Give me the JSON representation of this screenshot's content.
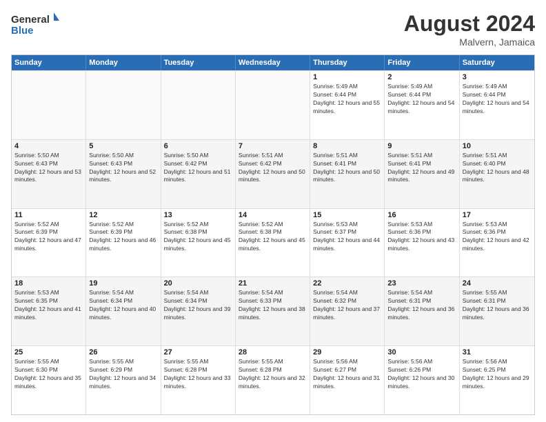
{
  "logo": {
    "general": "General",
    "blue": "Blue"
  },
  "header": {
    "title": "August 2024",
    "subtitle": "Malvern, Jamaica"
  },
  "days": [
    "Sunday",
    "Monday",
    "Tuesday",
    "Wednesday",
    "Thursday",
    "Friday",
    "Saturday"
  ],
  "rows": [
    [
      {
        "day": "",
        "empty": true
      },
      {
        "day": "",
        "empty": true
      },
      {
        "day": "",
        "empty": true
      },
      {
        "day": "",
        "empty": true
      },
      {
        "day": "1",
        "sunrise": "5:49 AM",
        "sunset": "6:44 PM",
        "daylight": "12 hours and 55 minutes."
      },
      {
        "day": "2",
        "sunrise": "5:49 AM",
        "sunset": "6:44 PM",
        "daylight": "12 hours and 54 minutes."
      },
      {
        "day": "3",
        "sunrise": "5:49 AM",
        "sunset": "6:44 PM",
        "daylight": "12 hours and 54 minutes."
      }
    ],
    [
      {
        "day": "4",
        "sunrise": "5:50 AM",
        "sunset": "6:43 PM",
        "daylight": "12 hours and 53 minutes."
      },
      {
        "day": "5",
        "sunrise": "5:50 AM",
        "sunset": "6:43 PM",
        "daylight": "12 hours and 52 minutes."
      },
      {
        "day": "6",
        "sunrise": "5:50 AM",
        "sunset": "6:42 PM",
        "daylight": "12 hours and 51 minutes."
      },
      {
        "day": "7",
        "sunrise": "5:51 AM",
        "sunset": "6:42 PM",
        "daylight": "12 hours and 50 minutes."
      },
      {
        "day": "8",
        "sunrise": "5:51 AM",
        "sunset": "6:41 PM",
        "daylight": "12 hours and 50 minutes."
      },
      {
        "day": "9",
        "sunrise": "5:51 AM",
        "sunset": "6:41 PM",
        "daylight": "12 hours and 49 minutes."
      },
      {
        "day": "10",
        "sunrise": "5:51 AM",
        "sunset": "6:40 PM",
        "daylight": "12 hours and 48 minutes."
      }
    ],
    [
      {
        "day": "11",
        "sunrise": "5:52 AM",
        "sunset": "6:39 PM",
        "daylight": "12 hours and 47 minutes."
      },
      {
        "day": "12",
        "sunrise": "5:52 AM",
        "sunset": "6:39 PM",
        "daylight": "12 hours and 46 minutes."
      },
      {
        "day": "13",
        "sunrise": "5:52 AM",
        "sunset": "6:38 PM",
        "daylight": "12 hours and 45 minutes."
      },
      {
        "day": "14",
        "sunrise": "5:52 AM",
        "sunset": "6:38 PM",
        "daylight": "12 hours and 45 minutes."
      },
      {
        "day": "15",
        "sunrise": "5:53 AM",
        "sunset": "6:37 PM",
        "daylight": "12 hours and 44 minutes."
      },
      {
        "day": "16",
        "sunrise": "5:53 AM",
        "sunset": "6:36 PM",
        "daylight": "12 hours and 43 minutes."
      },
      {
        "day": "17",
        "sunrise": "5:53 AM",
        "sunset": "6:36 PM",
        "daylight": "12 hours and 42 minutes."
      }
    ],
    [
      {
        "day": "18",
        "sunrise": "5:53 AM",
        "sunset": "6:35 PM",
        "daylight": "12 hours and 41 minutes."
      },
      {
        "day": "19",
        "sunrise": "5:54 AM",
        "sunset": "6:34 PM",
        "daylight": "12 hours and 40 minutes."
      },
      {
        "day": "20",
        "sunrise": "5:54 AM",
        "sunset": "6:34 PM",
        "daylight": "12 hours and 39 minutes."
      },
      {
        "day": "21",
        "sunrise": "5:54 AM",
        "sunset": "6:33 PM",
        "daylight": "12 hours and 38 minutes."
      },
      {
        "day": "22",
        "sunrise": "5:54 AM",
        "sunset": "6:32 PM",
        "daylight": "12 hours and 37 minutes."
      },
      {
        "day": "23",
        "sunrise": "5:54 AM",
        "sunset": "6:31 PM",
        "daylight": "12 hours and 36 minutes."
      },
      {
        "day": "24",
        "sunrise": "5:55 AM",
        "sunset": "6:31 PM",
        "daylight": "12 hours and 36 minutes."
      }
    ],
    [
      {
        "day": "25",
        "sunrise": "5:55 AM",
        "sunset": "6:30 PM",
        "daylight": "12 hours and 35 minutes."
      },
      {
        "day": "26",
        "sunrise": "5:55 AM",
        "sunset": "6:29 PM",
        "daylight": "12 hours and 34 minutes."
      },
      {
        "day": "27",
        "sunrise": "5:55 AM",
        "sunset": "6:28 PM",
        "daylight": "12 hours and 33 minutes."
      },
      {
        "day": "28",
        "sunrise": "5:55 AM",
        "sunset": "6:28 PM",
        "daylight": "12 hours and 32 minutes."
      },
      {
        "day": "29",
        "sunrise": "5:56 AM",
        "sunset": "6:27 PM",
        "daylight": "12 hours and 31 minutes."
      },
      {
        "day": "30",
        "sunrise": "5:56 AM",
        "sunset": "6:26 PM",
        "daylight": "12 hours and 30 minutes."
      },
      {
        "day": "31",
        "sunrise": "5:56 AM",
        "sunset": "6:25 PM",
        "daylight": "12 hours and 29 minutes."
      }
    ]
  ]
}
